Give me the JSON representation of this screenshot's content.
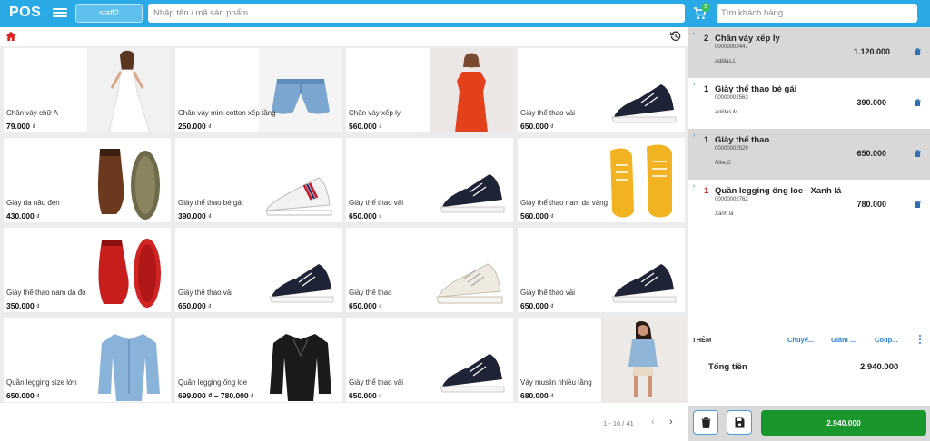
{
  "header": {
    "logo": "POS",
    "staff_label": "staff2",
    "search_placeholder": "Nhập tên / mã sản phẩm",
    "cart_count": "5",
    "customer_placeholder": "Tìm khách hàng"
  },
  "colors": {
    "brand": "#29a9e6",
    "pay": "#19962c",
    "accent": "#2a7fd0",
    "qty_alert": "#dd2222"
  },
  "products": [
    {
      "name": "Chân váy chữ A",
      "price": "79.000",
      "unit": "₫",
      "image": "white-dress"
    },
    {
      "name": "Chân váy mini cotton xếp tầng",
      "price": "250.000",
      "unit": "₫",
      "image": "denim-shorts"
    },
    {
      "name": "Chân váy xếp ly",
      "price": "560.000",
      "unit": "₫",
      "image": "red-dress"
    },
    {
      "name": "Giày thể thao vải",
      "price": "650.000",
      "unit": "₫",
      "image": "navy-sneaker"
    },
    {
      "name": "Giày da nâu đen",
      "price": "430.000",
      "unit": "₫",
      "image": "brown-boots"
    },
    {
      "name": "Giày thể thao bé gái",
      "price": "390.000",
      "unit": "₫",
      "image": "white-sneaker"
    },
    {
      "name": "Giày thể thao vải",
      "price": "650.000",
      "unit": "₫",
      "image": "navy-sneaker"
    },
    {
      "name": "Giày thể thao nam da vàng",
      "price": "560.000",
      "unit": "₫",
      "image": "yellow-sneakers"
    },
    {
      "name": "Giày thể thao nam da đỏ",
      "price": "350.000",
      "unit": "₫",
      "image": "red-sneakers"
    },
    {
      "name": "Giày thể thao vải",
      "price": "650.000",
      "unit": "₫",
      "image": "navy-sneaker"
    },
    {
      "name": "Giày thể thao",
      "price": "650.000",
      "unit": "₫",
      "image": "cream-sneaker"
    },
    {
      "name": "Giày thể thao vải",
      "price": "650.000",
      "unit": "₫",
      "image": "navy-sneaker"
    },
    {
      "name": "Quần legging size lớn",
      "price": "650.000",
      "unit": "₫",
      "image": "denim-jacket"
    },
    {
      "name": "Quần legging ống loe",
      "price": "699.000 ₫ – 780.000",
      "unit": "₫",
      "image": "leather-jacket"
    },
    {
      "name": "Giày thể thao vải",
      "price": "650.000",
      "unit": "₫",
      "image": "navy-sneaker"
    },
    {
      "name": "Váy muslin nhiều tầng",
      "price": "680.000",
      "unit": "₫",
      "image": "kid-denim"
    }
  ],
  "pagination": {
    "label": "1 - 16 / 41",
    "prev": "‹",
    "next": "›"
  },
  "cart": {
    "items": [
      {
        "qty": "2",
        "name": "Chân váy xếp ly",
        "code": "00000002447",
        "variant": "Adidas,L",
        "amount": "1.120.000"
      },
      {
        "qty": "1",
        "name": "Giày thể thao bé gái",
        "code": "00000002563",
        "variant": "Adidas,M",
        "amount": "390.000"
      },
      {
        "qty": "1",
        "name": "Giày thể thao",
        "code": "00000002529",
        "variant": "Nike,S",
        "amount": "650.000"
      },
      {
        "qty": "1",
        "name": "Quần legging ống loe - Xanh lá",
        "code": "00000002762",
        "variant": "Xanh lá",
        "amount": "780.000"
      }
    ],
    "add_label": "THÊM",
    "options": [
      "Chuyể...",
      "Giảm ...",
      "Coup..."
    ],
    "total_label": "Tổng tiền",
    "total_value": "2.940.000",
    "pay_label": "2.940.000"
  }
}
